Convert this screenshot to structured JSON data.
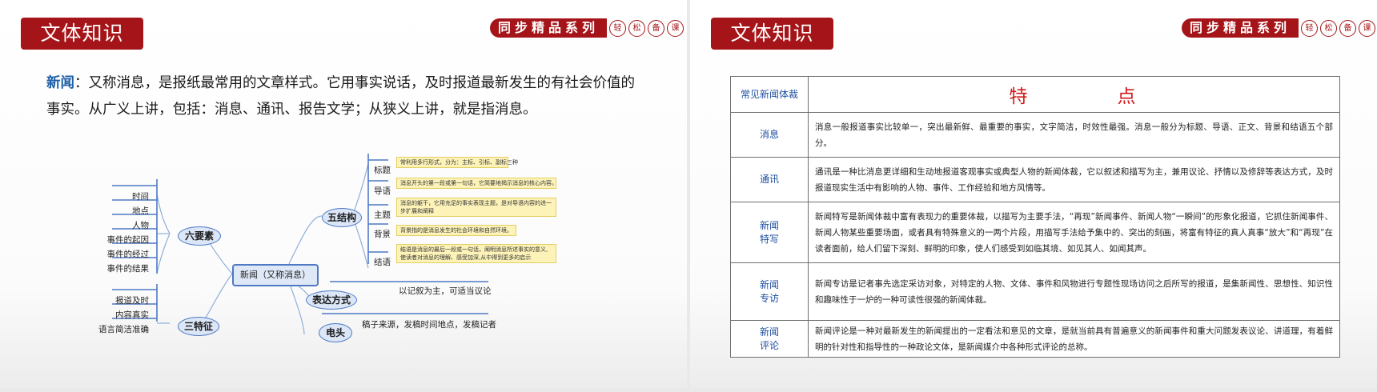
{
  "left_slide": {
    "title": "文体知识",
    "brand": {
      "main": "同步精品系列",
      "seals": [
        "轻",
        "松",
        "备",
        "课"
      ]
    },
    "intro": {
      "term": "新闻",
      "text": "：又称消息，是报纸最常用的文章样式。它用事实说话，及时报道最新发生的有社会价值的事实。从广义上讲，包括：消息、通讯、报告文学；从狭义上讲，就是指消息。"
    },
    "mindmap": {
      "center": "新闻（又称消息）",
      "six_elements": {
        "label": "六要素",
        "items": [
          "时间",
          "地点",
          "人物",
          "事件的起因",
          "事件的经过",
          "事件的结果"
        ]
      },
      "three_features": {
        "label": "三特征",
        "items": [
          "报道及时",
          "内容真实",
          "语言简洁准确"
        ]
      },
      "five_structure": {
        "label": "五结构",
        "items": [
          {
            "name": "标题",
            "note": "常利用多行形式，分为：主标、引标、副标三种"
          },
          {
            "name": "导语",
            "note": "消息开头的第一段或第一句话，它简要地揭示消息的核心内容。"
          },
          {
            "name": "主题",
            "note": "消息的躯干，它用充足的事实表现主题，是对导语内容的进一步扩展和阐释"
          },
          {
            "name": "背景",
            "note": "背景指的是消息发生的社会环境和自然环境。"
          },
          {
            "name": "结语",
            "note": "结语是消息的最后一段或一句话，阐明消息所述事实的意义,使读者对消息的理解、感受加深,从中得到更多的启示"
          }
        ]
      },
      "expression": {
        "label": "表达方式",
        "text": "以记叙为主，可适当议论"
      },
      "dateline": {
        "label": "电头",
        "text": "稿子来源，发稿时间地点，发稿记者"
      }
    }
  },
  "right_slide": {
    "title": "文体知识",
    "brand": {
      "main": "同步精品系列",
      "seals": [
        "轻",
        "松",
        "备",
        "课"
      ]
    },
    "table": {
      "header_type": "常见新闻体裁",
      "header_feature": "特　　　　点",
      "rows": [
        {
          "type": "消息",
          "desc": "消息一般报道事实比较单一，突出最新鲜、最重要的事实，文字简洁，时效性最强。消息一般分为标题、导语、正文、背景和结语五个部分。"
        },
        {
          "type": "通讯",
          "desc": "通讯是一种比消息更详细和生动地报道客观事实或典型人物的新闻体裁，它以叙述和描写为主，兼用议论、抒情以及修辞等表达方式，及时报道现实生活中有影响的人物、事件、工作经验和地方风情等。"
        },
        {
          "type": "新闻\n特写",
          "desc": "新闻特写是新闻体裁中富有表现力的重要体裁，以描写为主要手法，“再现”新闻事件、新闻人物“一瞬间”的形象化报道，它抓住新闻事件、新闻人物某些重要场面，或者具有特殊意义的一两个片段，用描写手法给予集中的、突出的刻画，将富有特征的真人真事“放大”和“再现”在读者面前，给人们留下深刻、鲜明的印象，使人们感受到如临其境、如见其人、如闻其声。"
        },
        {
          "type": "新闻\n专访",
          "desc": "新闻专访是记者事先选定采访对象，对特定的人物、文体、事件和风物进行专题性现场访问之后所写的报道，是集新闻性、思想性、知识性和趣味性于一炉的一种可读性很强的新闻体裁。"
        },
        {
          "type": "新闻\n评论",
          "desc": "新闻评论是一种对最新发生的新闻提出的一定看法和意见的文章，是就当前具有普遍意义的新闻事件和重大问题发表议论、讲道理，有着鲜明的针对性和指导性的一种政论文体，是新闻媒介中各种形式评论的总称。"
        }
      ]
    }
  },
  "colors": {
    "accent_red": "#a51418",
    "term_blue": "#1d5fa8",
    "feature_red": "#d11a1a"
  }
}
